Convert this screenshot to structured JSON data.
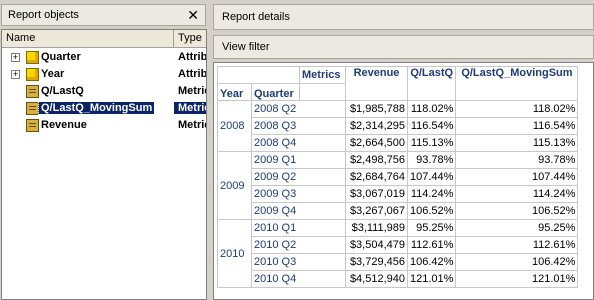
{
  "left_panel": {
    "title": "Report objects",
    "close_glyph": "✕",
    "columns": {
      "name": "Name",
      "type": "Type"
    },
    "objects": [
      {
        "name": "Quarter",
        "type": "Attrib",
        "kind": "attribute",
        "expandable": true,
        "expander": "+"
      },
      {
        "name": "Year",
        "type": "Attrib",
        "kind": "attribute",
        "expandable": true,
        "expander": "+"
      },
      {
        "name": "Q/LastQ",
        "type": "Metric",
        "kind": "metric",
        "expandable": false
      },
      {
        "name": "Q/LastQ_MovingSum",
        "type": "Metric",
        "kind": "metric",
        "expandable": false,
        "selected": true
      },
      {
        "name": "Revenue",
        "type": "Metric",
        "kind": "metric",
        "expandable": false
      }
    ]
  },
  "right_panel": {
    "title": "Report details",
    "view_filter": "View filter"
  },
  "grid": {
    "metrics_label": "Metrics",
    "row_headers": [
      "Year",
      "Quarter"
    ],
    "metric_columns": [
      "Revenue",
      "Q/LastQ",
      "Q/LastQ_MovingSum"
    ],
    "groups": [
      {
        "year": "2008",
        "rows": [
          {
            "quarter": "2008 Q2",
            "revenue": "$1,985,788",
            "qlastq": "118.02%",
            "moving": "118.02%"
          },
          {
            "quarter": "2008 Q3",
            "revenue": "$2,314,295",
            "qlastq": "116.54%",
            "moving": "116.54%"
          },
          {
            "quarter": "2008 Q4",
            "revenue": "$2,664,500",
            "qlastq": "115.13%",
            "moving": "115.13%"
          }
        ]
      },
      {
        "year": "2009",
        "rows": [
          {
            "quarter": "2009 Q1",
            "revenue": "$2,498,756",
            "qlastq": "93.78%",
            "moving": "93.78%"
          },
          {
            "quarter": "2009 Q2",
            "revenue": "$2,684,764",
            "qlastq": "107.44%",
            "moving": "107.44%"
          },
          {
            "quarter": "2009 Q3",
            "revenue": "$3,067,019",
            "qlastq": "114.24%",
            "moving": "114.24%"
          },
          {
            "quarter": "2009 Q4",
            "revenue": "$3,267,067",
            "qlastq": "106.52%",
            "moving": "106.52%"
          }
        ]
      },
      {
        "year": "2010",
        "rows": [
          {
            "quarter": "2010 Q1",
            "revenue": "$3,111,989",
            "qlastq": "95.25%",
            "moving": "95.25%"
          },
          {
            "quarter": "2010 Q2",
            "revenue": "$3,504,479",
            "qlastq": "112.61%",
            "moving": "112.61%"
          },
          {
            "quarter": "2010 Q3",
            "revenue": "$3,729,456",
            "qlastq": "106.42%",
            "moving": "106.42%"
          },
          {
            "quarter": "2010 Q4",
            "revenue": "$4,512,940",
            "qlastq": "121.01%",
            "moving": "121.01%"
          }
        ]
      }
    ]
  }
}
